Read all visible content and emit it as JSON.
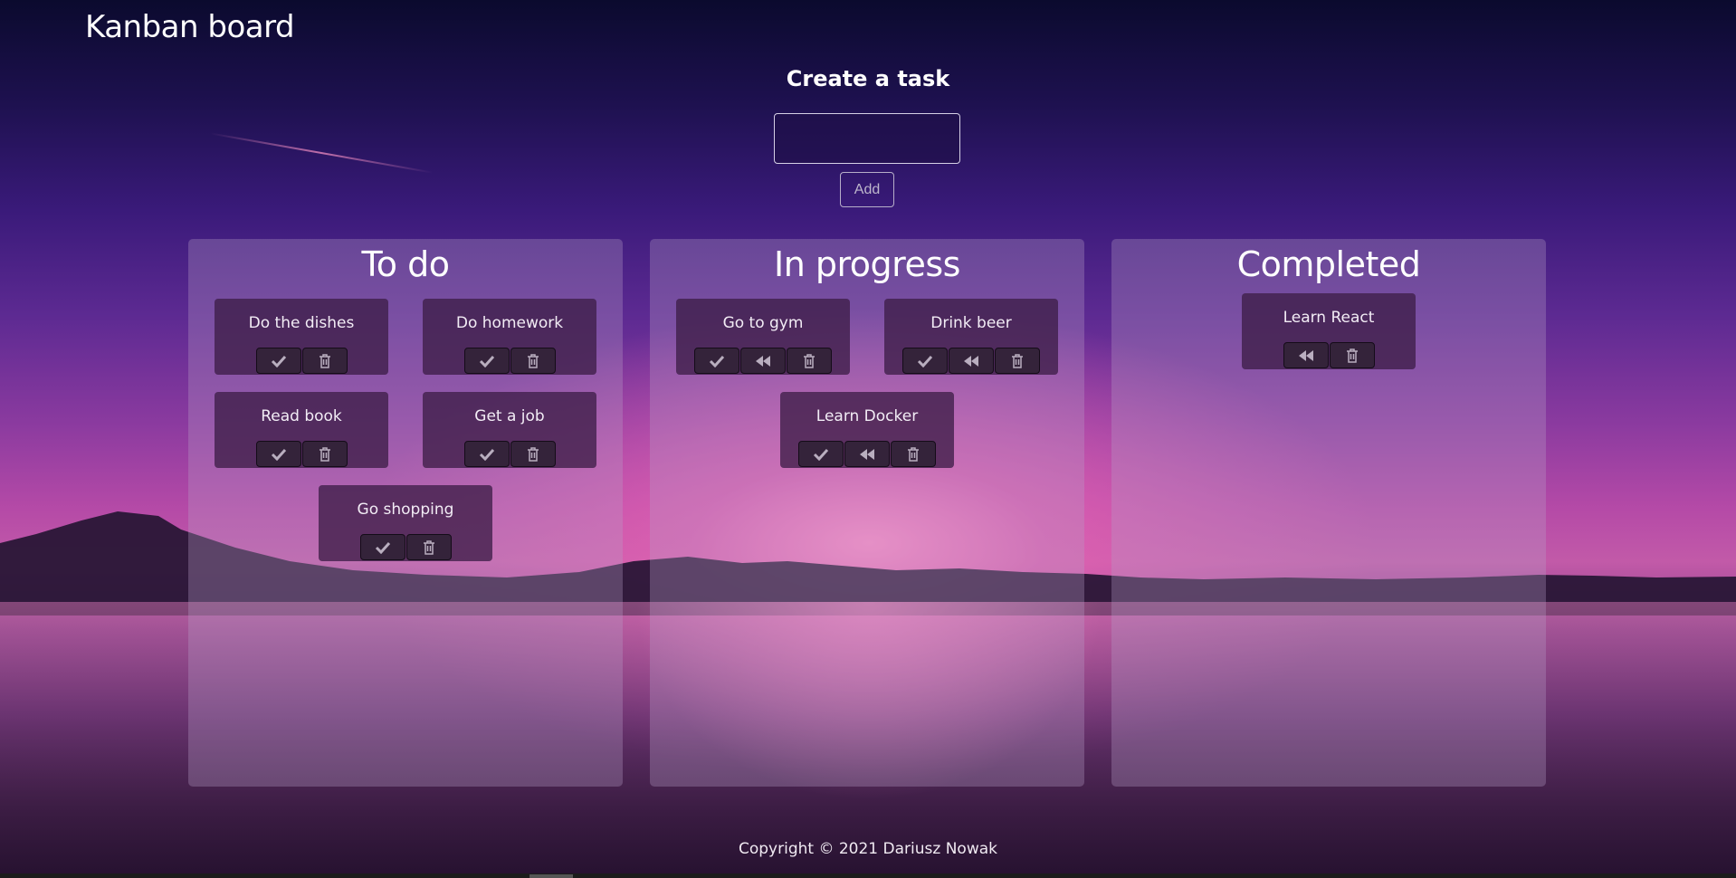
{
  "header": {
    "title": "Kanban board"
  },
  "create": {
    "title": "Create a task",
    "input_value": "",
    "add_label": "Add"
  },
  "columns": {
    "todo": {
      "title": "To do",
      "cards": [
        {
          "title": "Do the dishes"
        },
        {
          "title": "Do homework"
        },
        {
          "title": "Read book"
        },
        {
          "title": "Get a job"
        },
        {
          "title": "Go shopping"
        }
      ]
    },
    "progress": {
      "title": "In progress",
      "cards": [
        {
          "title": "Go to gym"
        },
        {
          "title": "Drink beer"
        },
        {
          "title": "Learn Docker"
        }
      ]
    },
    "completed": {
      "title": "Completed",
      "cards": [
        {
          "title": "Learn React"
        }
      ]
    }
  },
  "icons": {
    "complete": "check-icon",
    "move_back": "rewind-icon",
    "delete": "trash-icon"
  },
  "footer": {
    "text": "Copyright © 2021 Dariusz Nowak"
  }
}
